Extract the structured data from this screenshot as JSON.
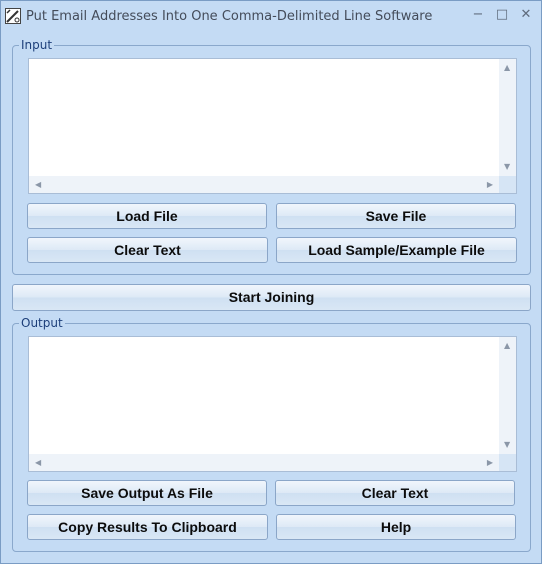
{
  "window": {
    "title": "Put Email Addresses Into One Comma-Delimited Line Software",
    "minimize_glyph": "−",
    "maximize_glyph": "□",
    "close_glyph": "✕"
  },
  "input": {
    "label": "Input",
    "text": "",
    "buttons": {
      "load_file": "Load File",
      "save_file": "Save File",
      "clear_text": "Clear Text",
      "load_sample": "Load Sample/Example File"
    }
  },
  "start_button": "Start Joining",
  "output": {
    "label": "Output",
    "text": "",
    "buttons": {
      "save_output": "Save Output As File",
      "clear_text": "Clear Text",
      "copy_results": "Copy Results To Clipboard",
      "help": "Help"
    }
  },
  "scroll_glyphs": {
    "up": "▲",
    "down": "▼",
    "left": "◀",
    "right": "▶"
  },
  "colors": {
    "window_bg": "#c4dbf4",
    "group_label": "#1d3f7a"
  }
}
